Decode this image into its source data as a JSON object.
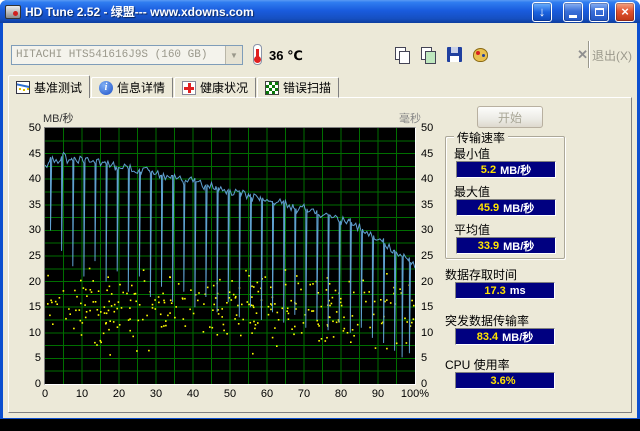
{
  "window": {
    "title": "HD Tune 2.52 - 绿盟--- www.xdowns.com",
    "controls": {
      "download_glyph": "↓",
      "close_glyph": "×"
    }
  },
  "toolbar": {
    "drive_select": "HITACHI HTS541616J9S (160 GB)",
    "drive_dropdown_glyph": "▼",
    "temperature": "36 ℃",
    "exit_label": "退出(X)",
    "exit_glyph": "✕",
    "icons": [
      "copy",
      "copy-image",
      "save",
      "palette"
    ]
  },
  "tabs": [
    {
      "label": "基准测试",
      "active": true
    },
    {
      "label": "信息详情",
      "active": false
    },
    {
      "label": "健康状况",
      "active": false
    },
    {
      "label": "错误扫描",
      "active": false
    }
  ],
  "results": {
    "start_button": "开始",
    "transfer_group_title": "传输速率",
    "items": [
      {
        "label": "最小值",
        "value": "5.2",
        "unit": "MB/秒"
      },
      {
        "label": "最大值",
        "value": "45.9",
        "unit": "MB/秒"
      },
      {
        "label": "平均值",
        "value": "33.9",
        "unit": "MB/秒"
      }
    ],
    "extra": [
      {
        "label": "数据存取时间",
        "value": "17.3",
        "unit": "ms"
      },
      {
        "label": "突发数据传输率",
        "value": "83.4",
        "unit": "MB/秒"
      },
      {
        "label": "CPU 使用率",
        "value": "3.6%",
        "unit": ""
      }
    ]
  },
  "colors": {
    "value_box_bg": "#000080",
    "value_number": "#FFE400",
    "titlebar_blue": "#1A5CDE",
    "client_bg": "#ECE9D8"
  },
  "chart_data": {
    "type": "line+scatter",
    "x_axis": {
      "min": 0,
      "max": 100,
      "tick_values": [
        0,
        10,
        20,
        30,
        40,
        50,
        60,
        70,
        80,
        90,
        100
      ],
      "tick_labels": [
        "0",
        "10",
        "20",
        "30",
        "40",
        "50",
        "60",
        "70",
        "80",
        "90",
        "100%"
      ]
    },
    "y_left": {
      "label": "MB/秒",
      "min": 0,
      "max": 50,
      "step": 5
    },
    "y_right": {
      "label": "毫秒",
      "min": 0,
      "max": 50,
      "step": 5
    },
    "grid_on": true,
    "grid_color": "#006E00",
    "bg_color": "#000000",
    "series": {
      "transfer_rate": {
        "name": "传输速率",
        "unit": "MB/秒",
        "color": "#5FA0D0",
        "base_points": [
          [
            0,
            42.5
          ],
          [
            2,
            44
          ],
          [
            4,
            43.2
          ],
          [
            5,
            45.3
          ],
          [
            6,
            43.8
          ],
          [
            8,
            44.2
          ],
          [
            10,
            43.6
          ],
          [
            12,
            43.9
          ],
          [
            14,
            43.2
          ],
          [
            16,
            43.5
          ],
          [
            18,
            42.8
          ],
          [
            20,
            42.2
          ],
          [
            22,
            42.6
          ],
          [
            24,
            41.8
          ],
          [
            26,
            41.4
          ],
          [
            28,
            41.8
          ],
          [
            30,
            41
          ],
          [
            32,
            40.5
          ],
          [
            34,
            40.8
          ],
          [
            36,
            40
          ],
          [
            38,
            39.4
          ],
          [
            40,
            39.8
          ],
          [
            42,
            39
          ],
          [
            44,
            38.4
          ],
          [
            46,
            38.7
          ],
          [
            48,
            38
          ],
          [
            50,
            37.4
          ],
          [
            52,
            37.7
          ],
          [
            54,
            37
          ],
          [
            56,
            36.4
          ],
          [
            58,
            36.6
          ],
          [
            60,
            36
          ],
          [
            62,
            35.3
          ],
          [
            64,
            35.6
          ],
          [
            66,
            34.8
          ],
          [
            68,
            34.2
          ],
          [
            70,
            34.5
          ],
          [
            72,
            33.8
          ],
          [
            74,
            33
          ],
          [
            76,
            33.3
          ],
          [
            78,
            32.5
          ],
          [
            80,
            31.8
          ],
          [
            82,
            32
          ],
          [
            84,
            31
          ],
          [
            86,
            30.2
          ],
          [
            88,
            29.4
          ],
          [
            90,
            28.4
          ],
          [
            92,
            27.4
          ],
          [
            94,
            26.2
          ],
          [
            96,
            25.2
          ],
          [
            98,
            24.2
          ],
          [
            100,
            23.2
          ]
        ],
        "spikes": [
          [
            1.5,
            30
          ],
          [
            4.5,
            26
          ],
          [
            7.5,
            23
          ],
          [
            10.5,
            21
          ],
          [
            13.5,
            24
          ],
          [
            16.5,
            20
          ],
          [
            19.5,
            22
          ],
          [
            22.5,
            18
          ],
          [
            25.5,
            21
          ],
          [
            28.5,
            17
          ],
          [
            31.5,
            19
          ],
          [
            34.5,
            16
          ],
          [
            37.5,
            18
          ],
          [
            40.5,
            15
          ],
          [
            43.5,
            17
          ],
          [
            46.5,
            14
          ],
          [
            49.5,
            16
          ],
          [
            52.5,
            13
          ],
          [
            55.5,
            15
          ],
          [
            58.5,
            12.5
          ],
          [
            61.5,
            14
          ],
          [
            64.5,
            12
          ],
          [
            67.5,
            13.5
          ],
          [
            70.5,
            11
          ],
          [
            73.5,
            12.5
          ],
          [
            76.5,
            10.5
          ],
          [
            79.5,
            12
          ],
          [
            82.5,
            10
          ],
          [
            85.5,
            11
          ],
          [
            88.5,
            9
          ],
          [
            91.5,
            8
          ],
          [
            94.5,
            6.5
          ],
          [
            96.5,
            5.2
          ],
          [
            98.5,
            6
          ]
        ]
      },
      "access_time": {
        "name": "存取时间",
        "unit": "ms",
        "color": "#FFFF00",
        "count": 300,
        "seed": 7,
        "y_mean": 14.5,
        "y_spread": 10,
        "y_min": 2.5,
        "y_max": 27
      }
    }
  }
}
